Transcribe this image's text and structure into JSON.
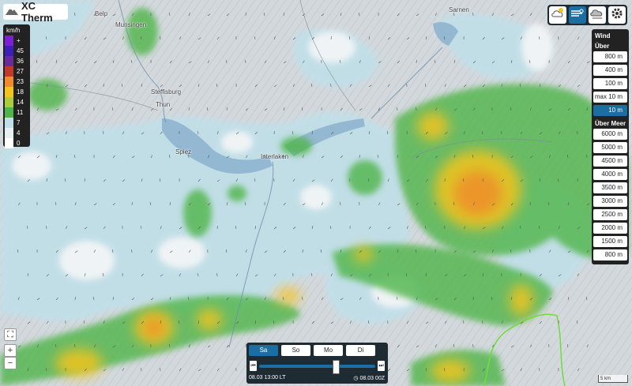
{
  "app": {
    "title": "XC Therm"
  },
  "map": {
    "towns": [
      "Belp",
      "Munsingen",
      "Sarnen",
      "Steffisburg",
      "Thun",
      "Spiez",
      "Interlaken"
    ]
  },
  "legend": {
    "unit": "km/h",
    "rows": [
      {
        "label": "+",
        "color": "#7a1fd6"
      },
      {
        "label": "45",
        "color": "#3b1fb8"
      },
      {
        "label": "36",
        "color": "#6a2b9a"
      },
      {
        "label": "27",
        "color": "#c0392b"
      },
      {
        "label": "23",
        "color": "#f08a2c"
      },
      {
        "label": "18",
        "color": "#f3c41c"
      },
      {
        "label": "14",
        "color": "#a8cf3a"
      },
      {
        "label": "11",
        "color": "#4fb54a"
      },
      {
        "label": "7",
        "color": "#bfe0ea"
      },
      {
        "label": "4",
        "color": "#e6f0f2"
      },
      {
        "label": "0",
        "color": "#ffffff"
      }
    ]
  },
  "top_controls": {
    "buttons": [
      {
        "icon": "thermal-cloud-icon"
      },
      {
        "icon": "wind-icon",
        "active": true
      },
      {
        "icon": "cloud-layer-icon"
      },
      {
        "icon": "gear-icon"
      }
    ]
  },
  "wind_panel": {
    "title": "Wind",
    "above_ground_label": "Über Grund",
    "above_ground": [
      "800 m",
      "400 m",
      "100 m",
      "max 10 m",
      "10 m"
    ],
    "active": "10 m",
    "above_sea_label": "Über Meer",
    "above_sea": [
      "6000 m",
      "5000 m",
      "4500 m",
      "4000 m",
      "3500 m",
      "3000 m",
      "2500 m",
      "2000 m",
      "1500 m",
      "800 m"
    ]
  },
  "map_controls": {
    "fullscreen": "⛶",
    "zoom_in": "+",
    "zoom_out": "−"
  },
  "time_panel": {
    "days": [
      "Sa",
      "So",
      "Mo",
      "Di"
    ],
    "active_day": "Sa",
    "skip_back": "⏮",
    "skip_forward": "⏭",
    "slider_position": 0.63,
    "local_time": "08.03 13:00 LT",
    "run_time": "08.03 00Z"
  },
  "scale_bar": {
    "label": "5 km"
  }
}
